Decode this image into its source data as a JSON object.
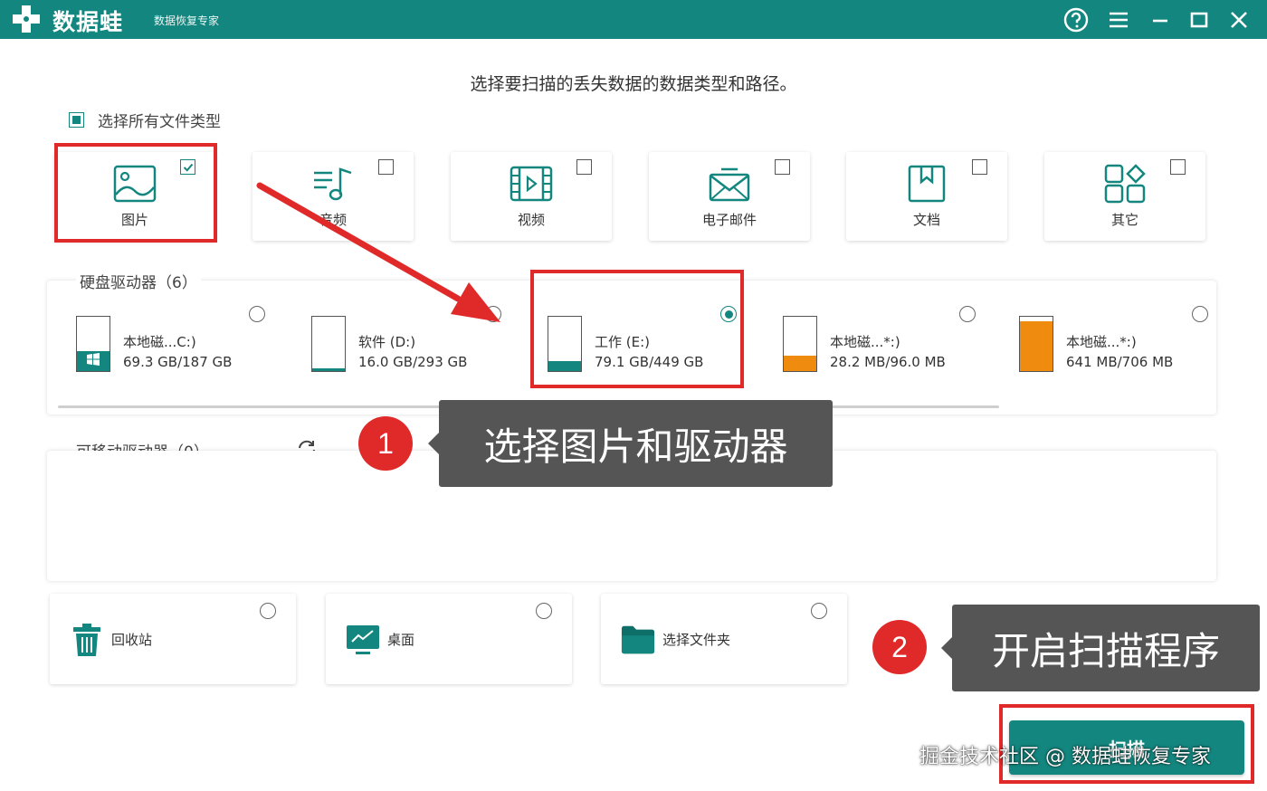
{
  "app": {
    "title": "数据蛙",
    "subtitle": "数据恢复专家"
  },
  "titlebar": {
    "icons": [
      "help-icon",
      "menu-icon",
      "minimize-icon",
      "maximize-icon",
      "close-icon"
    ]
  },
  "instruction": "选择要扫描的丢失数据的数据类型和路径。",
  "select_all": {
    "label": "选择所有文件类型",
    "state": "partial"
  },
  "file_types": [
    {
      "label": "图片",
      "icon": "image-icon",
      "checked": true
    },
    {
      "label": "音频",
      "icon": "audio-icon",
      "checked": false
    },
    {
      "label": "视频",
      "icon": "video-icon",
      "checked": false
    },
    {
      "label": "电子邮件",
      "icon": "email-icon",
      "checked": false
    },
    {
      "label": "文档",
      "icon": "document-icon",
      "checked": false
    },
    {
      "label": "其它",
      "icon": "other-icon",
      "checked": false
    }
  ],
  "hard_drives": {
    "label": "硬盘驱动器（6）",
    "items": [
      {
        "name": "本地磁...C:)",
        "size": "69.3 GB/187 GB",
        "used_fraction": 0.37,
        "color": "#13877f",
        "selected": false,
        "os_drive": true
      },
      {
        "name": "软件 (D:)",
        "size": "16.0 GB/293 GB",
        "used_fraction": 0.05,
        "color": "#13877f",
        "selected": false,
        "os_drive": false
      },
      {
        "name": "工作 (E:)",
        "size": "79.1 GB/449 GB",
        "used_fraction": 0.18,
        "color": "#13877f",
        "selected": true,
        "os_drive": false
      },
      {
        "name": "本地磁...*:)",
        "size": "28.2 MB/96.0 MB",
        "used_fraction": 0.29,
        "color": "#ef8c10",
        "selected": false,
        "os_drive": false
      },
      {
        "name": "本地磁...*:)",
        "size": "641 MB/706 MB",
        "used_fraction": 0.91,
        "color": "#ef8c10",
        "selected": false,
        "os_drive": false
      }
    ]
  },
  "removable_drives": {
    "label": "可移动驱动器（0）"
  },
  "locations": [
    {
      "label": "回收站",
      "icon": "recycle-bin-icon"
    },
    {
      "label": "桌面",
      "icon": "desktop-icon"
    },
    {
      "label": "选择文件夹",
      "icon": "folder-icon"
    }
  ],
  "scan_button": "扫描",
  "annotations": {
    "step1_number": "1",
    "step1_text": "选择图片和驱动器",
    "step2_number": "2",
    "step2_text": "开启扫描程序",
    "red_color": "#e02a2a"
  },
  "watermark": "掘金技术社区 @ 数据蛙恢复专家",
  "colors": {
    "accent": "#13877f",
    "warning_drive": "#ef8c10"
  }
}
